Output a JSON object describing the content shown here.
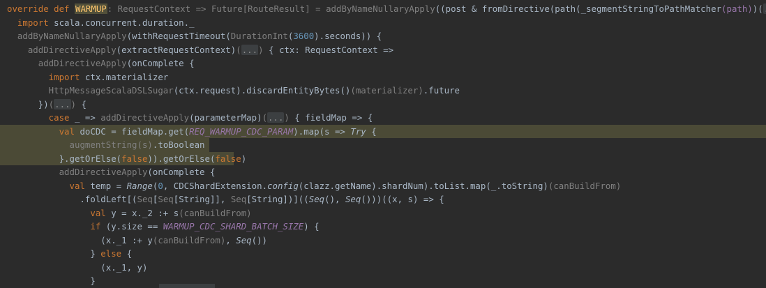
{
  "lines": [
    [
      {
        "t": "override def ",
        "c": "kw"
      },
      {
        "t": "WARMUP",
        "c": "hl-word"
      },
      {
        "t": ": RequestContext => Future[RouteResult] = ",
        "c": "gray"
      },
      {
        "t": "addByNameNullaryApply",
        "c": "gray"
      },
      {
        "t": "((post & ",
        "c": ""
      },
      {
        "t": "fromDirective",
        "c": ""
      },
      {
        "t": "(path(",
        "c": ""
      },
      {
        "t": "_segmentStringToPathMatcher",
        "c": ""
      },
      {
        "t": "(path)",
        "c": "purple"
      },
      {
        "t": ")(",
        "c": ""
      },
      {
        "t": "...",
        "c": "ellipsis"
      },
      {
        "t": ")) {",
        "c": ""
      }
    ],
    [
      {
        "t": "  import ",
        "c": "kw"
      },
      {
        "t": "scala.concurrent.duration._",
        "c": ""
      }
    ],
    [
      {
        "t": "  addByNameNullaryApply",
        "c": "gray"
      },
      {
        "t": "(withRequestTimeout(",
        "c": ""
      },
      {
        "t": "DurationInt",
        "c": "gray"
      },
      {
        "t": "(",
        "c": ""
      },
      {
        "t": "3600",
        "c": "num"
      },
      {
        "t": ").seconds)) {",
        "c": ""
      }
    ],
    [
      {
        "t": "    addDirectiveApply",
        "c": "gray"
      },
      {
        "t": "(extractRequestContext)",
        "c": ""
      },
      {
        "t": "(",
        "c": "gray"
      },
      {
        "t": "...",
        "c": "ellipsis"
      },
      {
        "t": ")",
        "c": "gray"
      },
      {
        "t": " { ctx: RequestContext =>",
        "c": ""
      }
    ],
    [
      {
        "t": "      addDirectiveApply",
        "c": "gray"
      },
      {
        "t": "(onComplete {",
        "c": ""
      }
    ],
    [
      {
        "t": "        import ",
        "c": "kw"
      },
      {
        "t": "ctx.materializer",
        "c": ""
      }
    ],
    [
      {
        "t": "        HttpMessageScalaDSLSugar",
        "c": "gray"
      },
      {
        "t": "(ctx.request)",
        "c": ""
      },
      {
        "t": ".discardEntityBytes()",
        "c": ""
      },
      {
        "t": "(materializer)",
        "c": "gray"
      },
      {
        "t": ".future",
        "c": ""
      }
    ],
    [
      {
        "t": "      })",
        "c": ""
      },
      {
        "t": "(",
        "c": "gray"
      },
      {
        "t": "...",
        "c": "ellipsis"
      },
      {
        "t": ")",
        "c": "gray"
      },
      {
        "t": " {",
        "c": ""
      }
    ],
    [
      {
        "t": "        case ",
        "c": "kw"
      },
      {
        "t": "_ => ",
        "c": ""
      },
      {
        "t": "addDirectiveApply",
        "c": "gray"
      },
      {
        "t": "(parameterMap)",
        "c": ""
      },
      {
        "t": "(",
        "c": "gray"
      },
      {
        "t": "...",
        "c": "ellipsis"
      },
      {
        "t": ")",
        "c": "gray"
      },
      {
        "t": " { fieldMap => {",
        "c": ""
      }
    ],
    [
      {
        "t": "          val ",
        "c": "kw"
      },
      {
        "t": "doCDC = fieldMap.get(",
        "c": ""
      },
      {
        "t": "REQ_WARMUP_CDC_PARAM",
        "c": "purple italic"
      },
      {
        "t": ").map(s => ",
        "c": ""
      },
      {
        "t": "Try",
        "c": "italic"
      },
      {
        "t": " {",
        "c": ""
      }
    ],
    [
      {
        "t": "            ",
        "c": ""
      },
      {
        "t": "augmentString",
        "c": "gray"
      },
      {
        "t": "(s)",
        "c": "gray"
      },
      {
        "t": ".toBoolean",
        "c": ""
      }
    ],
    [
      {
        "t": "          }.getOrElse(",
        "c": ""
      },
      {
        "t": "false",
        "c": "kw"
      },
      {
        "t": ")).getOrElse(",
        "c": ""
      },
      {
        "t": "false",
        "c": "kw"
      },
      {
        "t": ")",
        "c": ""
      }
    ],
    [
      {
        "t": "          addDirectiveApply",
        "c": "gray"
      },
      {
        "t": "(onComplete {",
        "c": ""
      }
    ],
    [
      {
        "t": "            val ",
        "c": "kw"
      },
      {
        "t": "temp = ",
        "c": ""
      },
      {
        "t": "Range",
        "c": "italic"
      },
      {
        "t": "(",
        "c": ""
      },
      {
        "t": "0",
        "c": "num"
      },
      {
        "t": ", CDCShardExtension.",
        "c": ""
      },
      {
        "t": "config",
        "c": "italic"
      },
      {
        "t": "(clazz.getName).shardNum).toList.map(_.toString)",
        "c": ""
      },
      {
        "t": "(canBuildFrom)",
        "c": "gray"
      }
    ],
    [
      {
        "t": "              .foldLeft[(",
        "c": ""
      },
      {
        "t": "Seq",
        "c": "gray"
      },
      {
        "t": "[",
        "c": ""
      },
      {
        "t": "Seq",
        "c": "gray"
      },
      {
        "t": "[String]], ",
        "c": ""
      },
      {
        "t": "Seq",
        "c": "gray"
      },
      {
        "t": "[String])]((",
        "c": ""
      },
      {
        "t": "Seq",
        "c": "italic"
      },
      {
        "t": "(), ",
        "c": ""
      },
      {
        "t": "Seq",
        "c": "italic"
      },
      {
        "t": "()))((x, s) => {",
        "c": ""
      }
    ],
    [
      {
        "t": "                val ",
        "c": "kw"
      },
      {
        "t": "y = x._2 :+ s",
        "c": ""
      },
      {
        "t": "(canBuildFrom)",
        "c": "gray"
      }
    ],
    [
      {
        "t": "                if ",
        "c": "kw"
      },
      {
        "t": "(y.size == ",
        "c": ""
      },
      {
        "t": "WARMUP_CDC_SHARD_BATCH_SIZE",
        "c": "purple italic"
      },
      {
        "t": ") {",
        "c": ""
      }
    ],
    [
      {
        "t": "                  (x._1 :+ y",
        "c": ""
      },
      {
        "t": "(canBuildFrom)",
        "c": "gray"
      },
      {
        "t": ", ",
        "c": ""
      },
      {
        "t": "Seq",
        "c": "italic"
      },
      {
        "t": "())",
        "c": ""
      }
    ],
    [
      {
        "t": "                } ",
        "c": ""
      },
      {
        "t": "else ",
        "c": "kw"
      },
      {
        "t": "{",
        "c": ""
      }
    ],
    [
      {
        "t": "                  (x._1, y)",
        "c": ""
      }
    ],
    [
      {
        "t": "                }",
        "c": ""
      }
    ],
    [
      {
        "t": "              })",
        "c": ""
      }
    ]
  ]
}
